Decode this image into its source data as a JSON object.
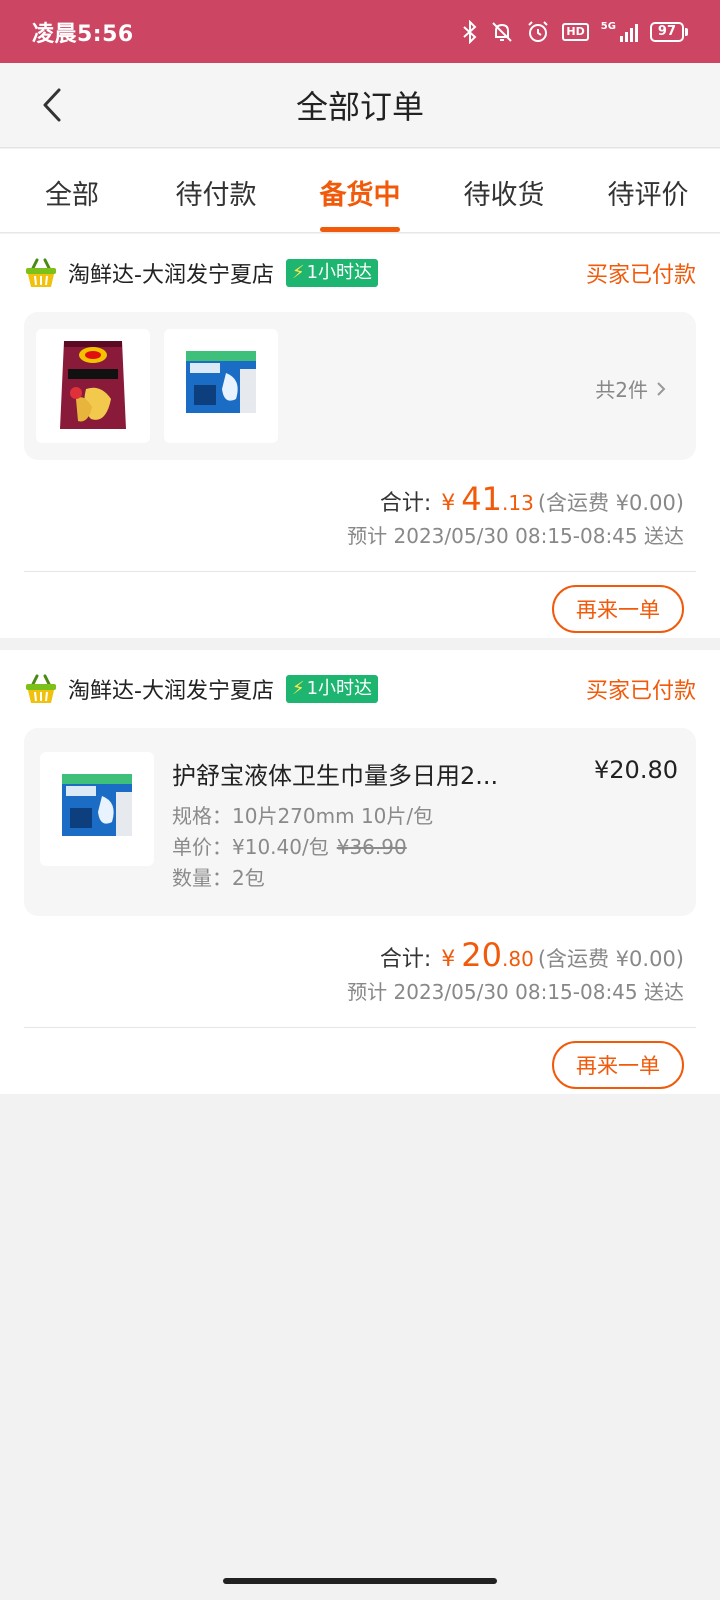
{
  "status_bar": {
    "time": "凌晨5:56",
    "network_label": "5G",
    "battery": "97",
    "hd_label": "HD"
  },
  "header": {
    "title": "全部订单"
  },
  "tabs": [
    {
      "label": "全部",
      "active": false
    },
    {
      "label": "待付款",
      "active": false
    },
    {
      "label": "备货中",
      "active": true
    },
    {
      "label": "待收货",
      "active": false
    },
    {
      "label": "待评价",
      "active": false
    }
  ],
  "orders": [
    {
      "shop_name": "淘鲜达-大润发宁夏店",
      "delivery_badge": "1小时达",
      "status": "买家已付款",
      "item_count_label": "共2件",
      "total_label": "合计:",
      "currency": "¥",
      "total_int": "41",
      "total_dec": ".13",
      "shipping": "(含运费 ¥0.00)",
      "eta": "预计 2023/05/30 08:15-08:45 送达",
      "reorder_label": "再来一单"
    },
    {
      "shop_name": "淘鲜达-大润发宁夏店",
      "delivery_badge": "1小时达",
      "status": "买家已付款",
      "product": {
        "title": "护舒宝液体卫生巾量多日用2...",
        "price": "¥20.80",
        "spec": "规格：10片270mm 10片/包",
        "unit_price": "单价：¥10.40/包",
        "original_price": "¥36.90",
        "quantity": "数量：2包"
      },
      "total_label": "合计:",
      "currency": "¥",
      "total_int": "20",
      "total_dec": ".80",
      "shipping": "(含运费 ¥0.00)",
      "eta": "预计 2023/05/30 08:15-08:45 送达",
      "reorder_label": "再来一单"
    }
  ],
  "colors": {
    "status_bar": "#cc4563",
    "accent": "#f05a0a",
    "badge_green": "#1db570"
  }
}
